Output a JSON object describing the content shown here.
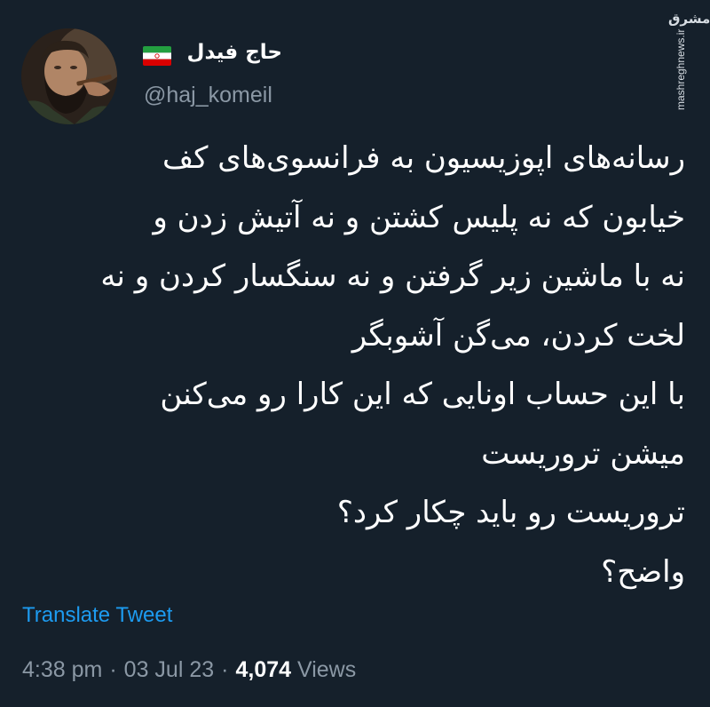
{
  "author": {
    "display_name": "حاج فیدل",
    "flag_icon": "iran-flag-icon",
    "handle": "@haj_komeil"
  },
  "watermark": {
    "logo_text": "مشرق",
    "domain": "mashreghnews.ir"
  },
  "tweet": {
    "lines": [
      "رسانه‌های اپوزیسیون به فرانسوی‌های کف",
      "خیابون که نه پلیس کشتن و نه آتیش زدن و",
      "نه با ماشین زیر گرفتن و نه سنگسار کردن و نه",
      "لخت کردن، می‌گن آشوبگر",
      "با این حساب اونایی که این کارا رو می‌کنن",
      "میشن تروریست",
      "تروریست رو باید چکار کرد؟",
      "واضح؟"
    ],
    "translate_label": "Translate Tweet"
  },
  "meta": {
    "time": "4:38 pm",
    "separator": "·",
    "date": "03 Jul 23",
    "views_count": "4,074",
    "views_label": "Views"
  },
  "colors": {
    "background": "#15202b",
    "text_primary": "#ffffff",
    "text_secondary": "#8b98a5",
    "link": "#1d9bf0"
  }
}
